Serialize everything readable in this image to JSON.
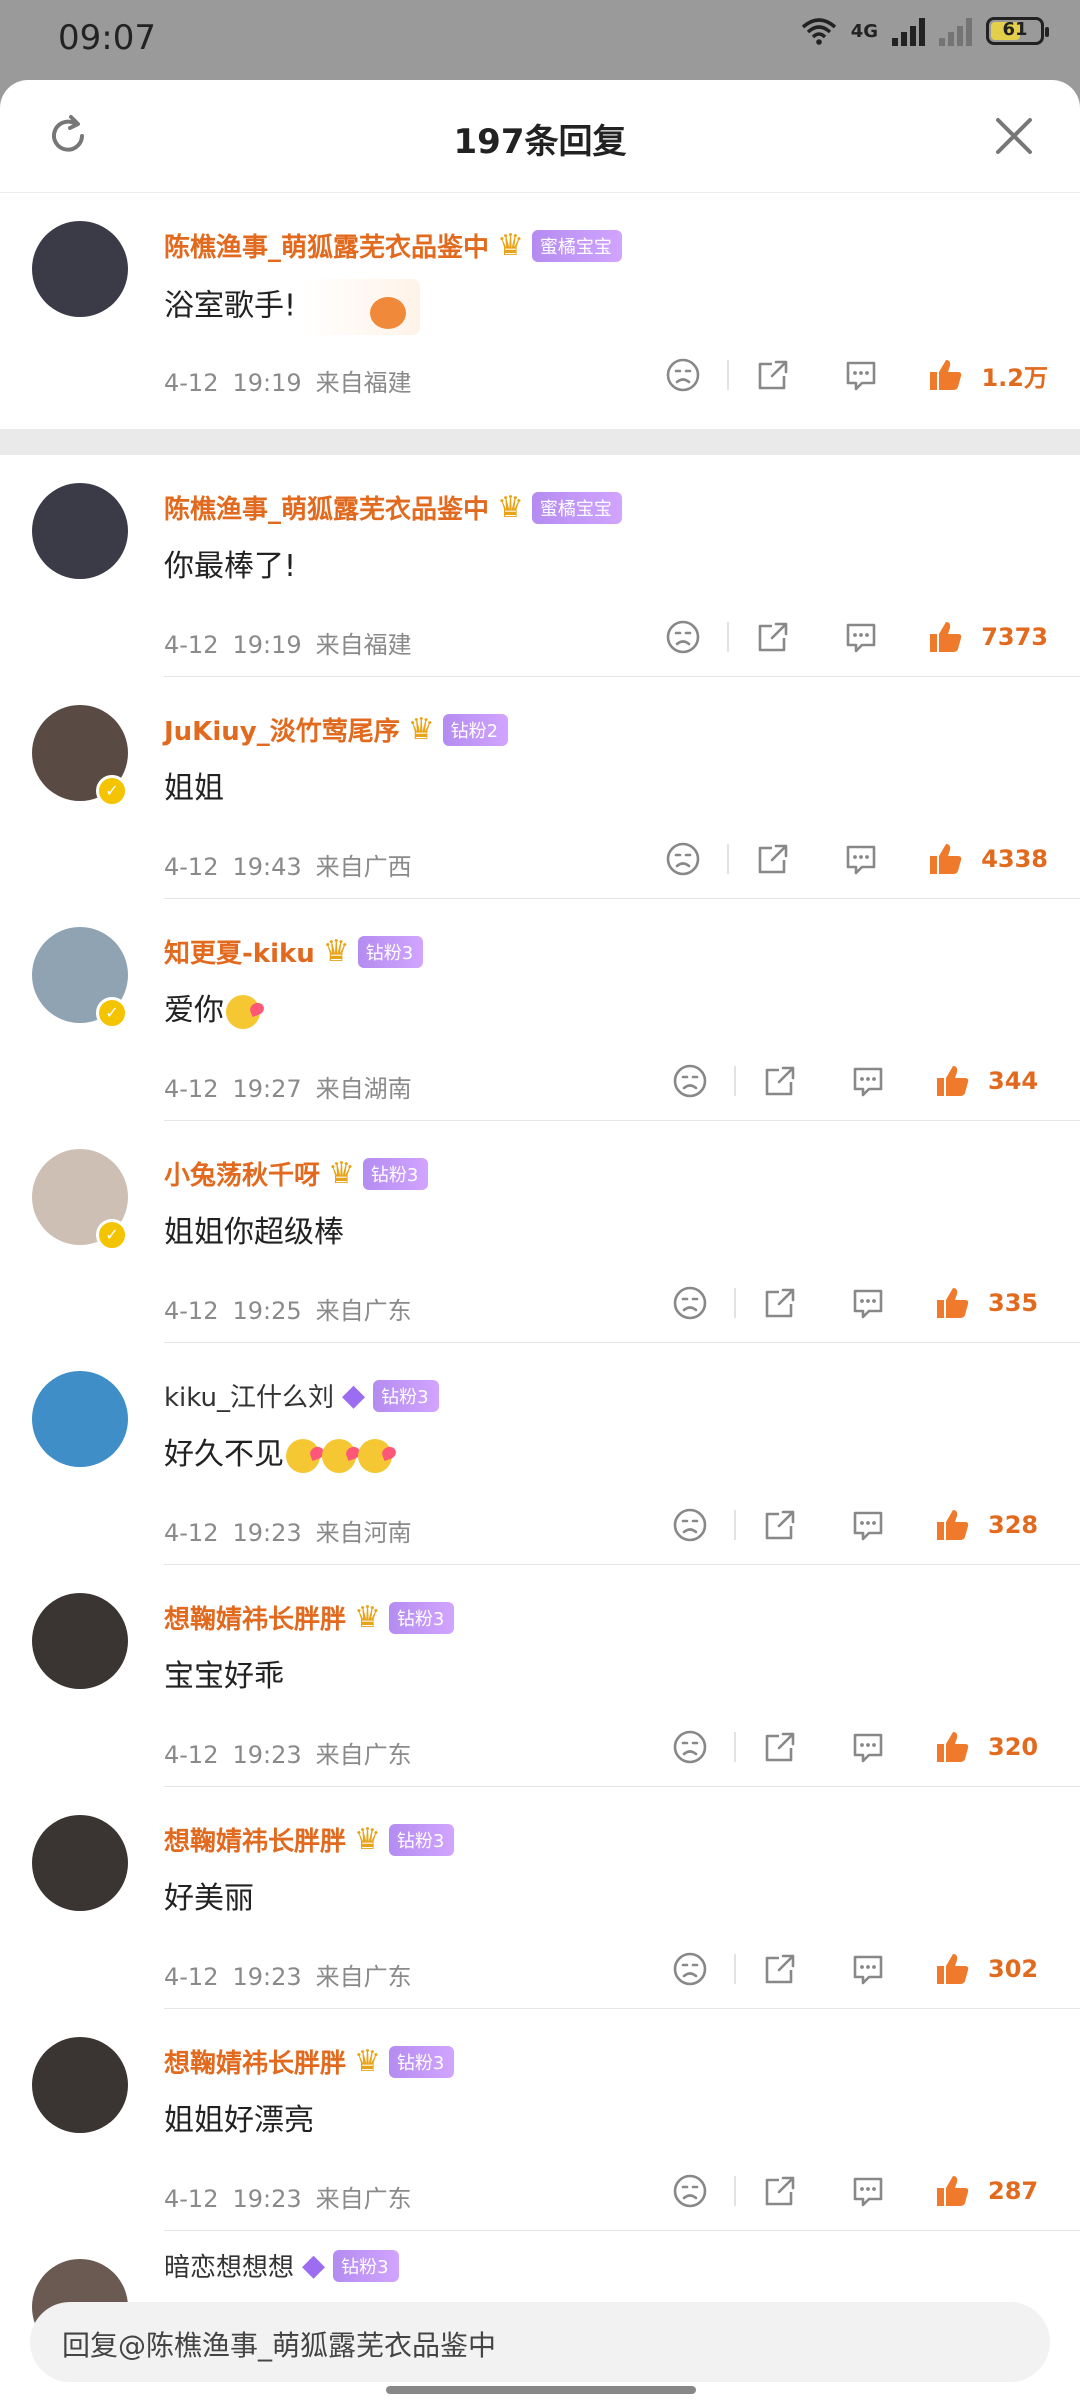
{
  "status_bar": {
    "time": "09:07",
    "network": "4G",
    "battery": "61",
    "battery_level": 0.61
  },
  "header": {
    "title": "197条回复"
  },
  "comments": [
    {
      "name": "陈樵渔事_萌狐露芜衣品鉴中",
      "badge": "蜜橘宝宝",
      "badge_icon": "crown-icon",
      "text": "浴室歌手!",
      "date": "4-12",
      "time": "19:19",
      "location": "来自福建",
      "likes": "1.2万",
      "avatar_color": "#3b3b48"
    },
    {
      "name": "陈樵渔事_萌狐露芜衣品鉴中",
      "badge": "蜜橘宝宝",
      "badge_icon": "crown-icon",
      "text": "你最棒了!",
      "date": "4-12",
      "time": "19:19",
      "location": "来自福建",
      "likes": "7373",
      "avatar_color": "#3b3b48"
    },
    {
      "name": "JuKiuy_淡竹莺尾序",
      "badge": "钻粉2",
      "badge_icon": "crown-icon",
      "text": "姐姐",
      "date": "4-12",
      "time": "19:43",
      "location": "来自广西",
      "likes": "4338",
      "avatar_color": "#5a4a44",
      "verified": true
    },
    {
      "name": "知更夏-kiku",
      "badge": "钻粉3",
      "badge_icon": "crown-icon",
      "text": "爱你",
      "date": "4-12",
      "time": "19:27",
      "location": "来自湖南",
      "likes": "344",
      "avatar_color": "#8fa3b2",
      "verified": true
    },
    {
      "name": "小兔荡秋千呀",
      "badge": "钻粉3",
      "badge_icon": "crown-icon",
      "text": "姐姐你超级棒",
      "date": "4-12",
      "time": "19:25",
      "location": "来自广东",
      "likes": "335",
      "avatar_color": "#cdbfb4",
      "verified": true
    },
    {
      "name": "kiku_江什么刘",
      "badge": "钻粉3",
      "badge_icon": "diamond-icon",
      "text": "好久不见",
      "date": "4-12",
      "time": "19:23",
      "location": "来自河南",
      "likes": "328",
      "avatar_color": "#3f8ec8",
      "plain": true
    },
    {
      "name": "想鞠婧祎长胖胖",
      "badge": "钻粉3",
      "badge_icon": "crown-icon",
      "text": "宝宝好乖",
      "date": "4-12",
      "time": "19:23",
      "location": "来自广东",
      "likes": "320",
      "avatar_color": "#3a3533"
    },
    {
      "name": "想鞠婧祎长胖胖",
      "badge": "钻粉3",
      "badge_icon": "crown-icon",
      "text": "好美丽",
      "date": "4-12",
      "time": "19:23",
      "location": "来自广东",
      "likes": "302",
      "avatar_color": "#3a3533"
    },
    {
      "name": "想鞠婧祎长胖胖",
      "badge": "钻粉3",
      "badge_icon": "crown-icon",
      "text": "姐姐好漂亮",
      "date": "4-12",
      "time": "19:23",
      "location": "来自广东",
      "likes": "287",
      "avatar_color": "#3a3533"
    }
  ],
  "partial_comment": {
    "name": "暗恋想想想",
    "badge": "钻粉3"
  },
  "reply_bar": {
    "placeholder": "回复@陈樵渔事_萌狐露芜衣品鉴中"
  },
  "colors": {
    "accent": "#e26a1f",
    "badge_purple": "#b48cf0",
    "background": "#ffffff"
  }
}
